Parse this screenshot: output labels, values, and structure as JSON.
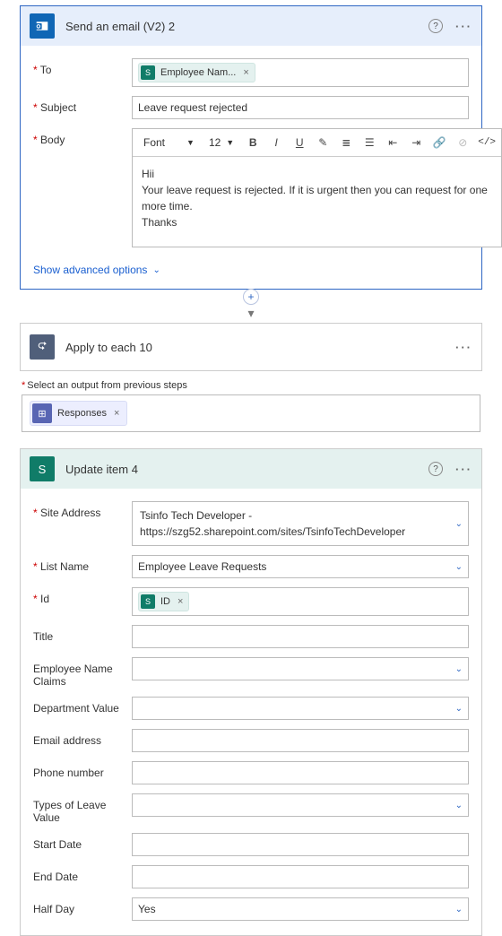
{
  "email_card": {
    "title": "Send an email (V2) 2",
    "to_label": "To",
    "to_token": "Employee Nam...",
    "subject_label": "Subject",
    "subject_value": "Leave request rejected",
    "body_label": "Body",
    "font_label": "Font",
    "fontsize": "12",
    "body_line1": "Hii",
    "body_line2": "Your leave request is rejected. If it is urgent then you can request for one more time.",
    "body_line3": "Thanks",
    "advanced": "Show advanced options"
  },
  "apply_card": {
    "title": "Apply to each 10",
    "output_label": "Select an output from previous steps",
    "responses_token": "Responses"
  },
  "update_card": {
    "title": "Update item 4",
    "fields": {
      "site_label": "Site Address",
      "site_l1": "Tsinfo Tech Developer -",
      "site_l2": "https://szg52.sharepoint.com/sites/TsinfoTechDeveloper",
      "list_label": "List Name",
      "list_value": "Employee Leave Requests",
      "id_label": "Id",
      "id_token": "ID",
      "title_label": "Title",
      "emp_label": "Employee Name Claims",
      "dept_label": "Department Value",
      "email_label": "Email address",
      "phone_label": "Phone number",
      "leave_label": "Types of Leave Value",
      "start_label": "Start Date",
      "end_label": "End Date",
      "half_label": "Half Day",
      "half_value": "Yes"
    }
  }
}
